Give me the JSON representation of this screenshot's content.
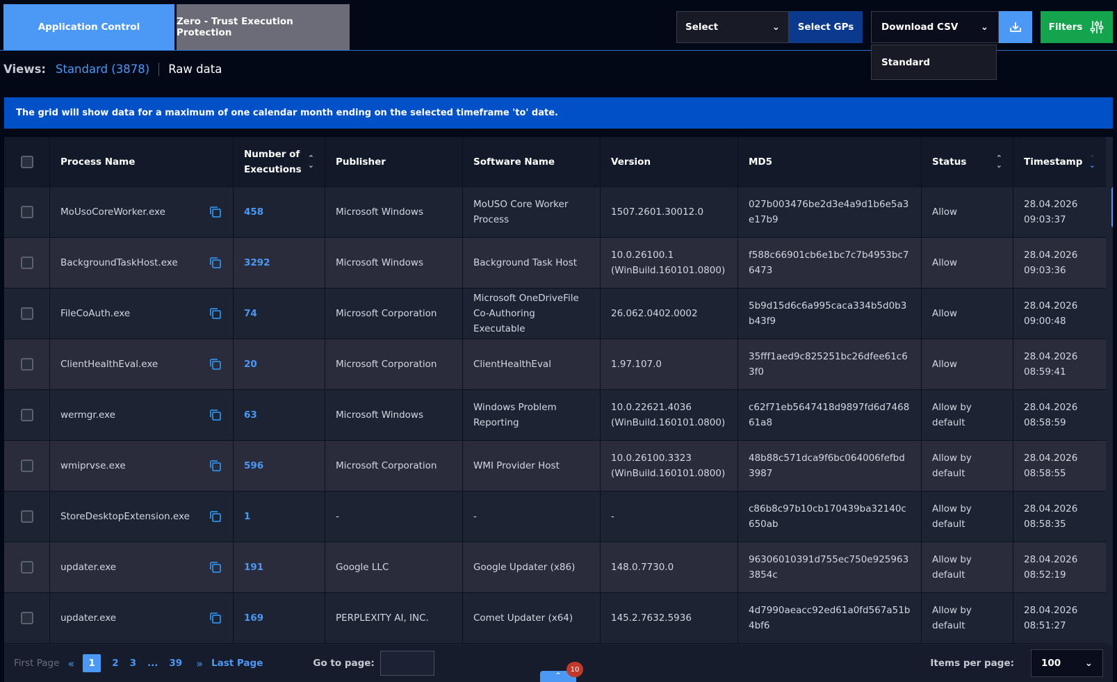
{
  "tabs": [
    {
      "label": "Application Control"
    },
    {
      "label": "Zero - Trust Execution Protection"
    }
  ],
  "controls": {
    "select_label": "Select",
    "select_gps_label": "Select GPs",
    "download_csv_label": "Download CSV",
    "filters_label": "Filters",
    "dropdown_option": "Standard"
  },
  "views": {
    "label": "Views:",
    "standard": "Standard (3878)",
    "raw": "Raw data"
  },
  "banner": "The grid will show data for a maximum of one calendar month ending on the selected timeframe 'to' date.",
  "table": {
    "headers": {
      "process": "Process Name",
      "executions": "Number of Executions",
      "publisher": "Publisher",
      "software": "Software Name",
      "version": "Version",
      "md5": "MD5",
      "status": "Status",
      "timestamp": "Timestamp"
    },
    "rows": [
      {
        "process": "MoUsoCoreWorker.exe",
        "executions": "458",
        "publisher": "Microsoft Windows",
        "software": "MoUSO Core Worker Process",
        "version": "1507.2601.30012.0",
        "md5": "027b003476be2d3e4a9d1b6e5a3e17b9",
        "status": "Allow",
        "timestamp": "28.04.2026 09:03:37"
      },
      {
        "process": "BackgroundTaskHost.exe",
        "executions": "3292",
        "publisher": "Microsoft Windows",
        "software": "Background Task Host",
        "version": "10.0.26100.1 (WinBuild.160101.0800)",
        "md5": "f588c66901cb6e1bc7c7b4953bc76473",
        "status": "Allow",
        "timestamp": "28.04.2026 09:03:36"
      },
      {
        "process": "FileCoAuth.exe",
        "executions": "74",
        "publisher": "Microsoft Corporation",
        "software": "Microsoft OneDriveFile Co-Authoring Executable",
        "version": "26.062.0402.0002",
        "md5": "5b9d15d6c6a995caca334b5d0b3b43f9",
        "status": "Allow",
        "timestamp": "28.04.2026 09:00:48"
      },
      {
        "process": "ClientHealthEval.exe",
        "executions": "20",
        "publisher": "Microsoft Corporation",
        "software": "ClientHealthEval",
        "version": "1.97.107.0",
        "md5": "35fff1aed9c825251bc26dfee61c63f0",
        "status": "Allow",
        "timestamp": "28.04.2026 08:59:41"
      },
      {
        "process": "wermgr.exe",
        "executions": "63",
        "publisher": "Microsoft Windows",
        "software": "Windows Problem Reporting",
        "version": "10.0.22621.4036 (WinBuild.160101.0800)",
        "md5": "c62f71eb5647418d9897fd6d746861a8",
        "status": "Allow by default",
        "timestamp": "28.04.2026 08:58:59"
      },
      {
        "process": "wmiprvse.exe",
        "executions": "596",
        "publisher": "Microsoft Corporation",
        "software": "WMI Provider Host",
        "version": "10.0.26100.3323 (WinBuild.160101.0800)",
        "md5": "48b88c571dca9f6bc064006fefbd3987",
        "status": "Allow by default",
        "timestamp": "28.04.2026 08:58:55"
      },
      {
        "process": "StoreDesktopExtension.exe",
        "executions": "1",
        "publisher": "-",
        "software": "-",
        "version": "-",
        "md5": "c86b8c97b10cb170439ba32140c650ab",
        "status": "Allow by default",
        "timestamp": "28.04.2026 08:58:35"
      },
      {
        "process": "updater.exe",
        "executions": "191",
        "publisher": "Google LLC",
        "software": "Google Updater (x86)",
        "version": "148.0.7730.0",
        "md5": "96306010391d755ec750e9259633854c",
        "status": "Allow by default",
        "timestamp": "28.04.2026 08:52:19"
      },
      {
        "process": "updater.exe",
        "executions": "169",
        "publisher": "PERPLEXITY AI, INC.",
        "software": "Comet Updater (x64)",
        "version": "145.2.7632.5936",
        "md5": "4d7990aeacc92ed61a0fd567a51b4bf6",
        "status": "Allow by default",
        "timestamp": "28.04.2026 08:51:27"
      }
    ]
  },
  "pager": {
    "first": "First Page",
    "pages": [
      "1",
      "2",
      "3",
      "...",
      "39"
    ],
    "last": "Last Page",
    "goto_label": "Go to page:",
    "items_per_page_label": "Items per page:",
    "items_per_page": "100"
  },
  "notification_badge": "10",
  "colors": {
    "accent": "#4b98f5",
    "banner": "#0050c8",
    "filters": "#14a44d",
    "background": "#030816"
  }
}
